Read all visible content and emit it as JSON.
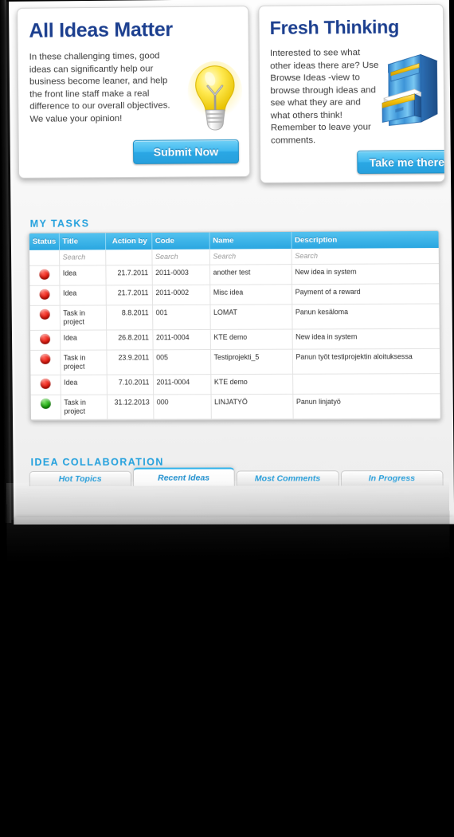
{
  "cards": {
    "ideas": {
      "title": "All Ideas Matter",
      "body": "In these challenging times, good ideas can significantly help our business become leaner, and help the front line staff make a real difference to our overall objectives. We value your opinion!",
      "button_label": "Submit Now",
      "icon": "lightbulb-icon"
    },
    "fresh": {
      "title": "Fresh Thinking",
      "body": "Interested to see what other ideas there are? Use Browse Ideas -view to browse through ideas and see what they are and what others think! Remember to leave your comments.",
      "button_label": "Take me there!",
      "icon": "filing-cabinet-icon"
    }
  },
  "sections": {
    "my_tasks_title": "MY TASKS",
    "idea_collaboration_title": "IDEA COLLABORATION"
  },
  "tasks_table": {
    "columns": [
      "Status",
      "Title",
      "Action by",
      "Code",
      "Name",
      "Description"
    ],
    "search_placeholder": "Search",
    "search_row": [
      "",
      "Search",
      "",
      "Search",
      "Search",
      "Search"
    ],
    "rows": [
      {
        "status": "red",
        "title": "Idea",
        "action_by": "21.7.2011",
        "code": "2011-0003",
        "name": "another test",
        "description": "New idea in system"
      },
      {
        "status": "red",
        "title": "Idea",
        "action_by": "21.7.2011",
        "code": "2011-0002",
        "name": "Misc idea",
        "description": "Payment of a reward"
      },
      {
        "status": "red",
        "title": "Task in project",
        "action_by": "8.8.2011",
        "code": "001",
        "name": "LOMAT",
        "description": "Panun kesäloma"
      },
      {
        "status": "red",
        "title": "Idea",
        "action_by": "26.8.2011",
        "code": "2011-0004",
        "name": "KTE demo",
        "description": "New idea in system"
      },
      {
        "status": "red",
        "title": "Task in project",
        "action_by": "23.9.2011",
        "code": "005",
        "name": "Testiprojekti_5",
        "description": "Panun työt testiprojektin aloituksessa"
      },
      {
        "status": "red",
        "title": "Idea",
        "action_by": "7.10.2011",
        "code": "2011-0004",
        "name": "KTE demo",
        "description": ""
      },
      {
        "status": "green",
        "title": "Task in project",
        "action_by": "31.12.2013",
        "code": "000",
        "name": "LINJATYÖ",
        "description": "Panun linjatyö"
      }
    ]
  },
  "collaboration_tabs": [
    {
      "label": "Hot Topics",
      "active": false
    },
    {
      "label": "Recent Ideas",
      "active": true
    },
    {
      "label": "Most Comments",
      "active": false
    },
    {
      "label": "In Progress",
      "active": false
    }
  ],
  "colors": {
    "accent_blue": "#22a0dd",
    "header_blue": "#3db4e8",
    "title_navy": "#1c3f8f",
    "status_red": "#e81d12",
    "status_green": "#1fab12",
    "page_bg": "#f4f4f4"
  }
}
